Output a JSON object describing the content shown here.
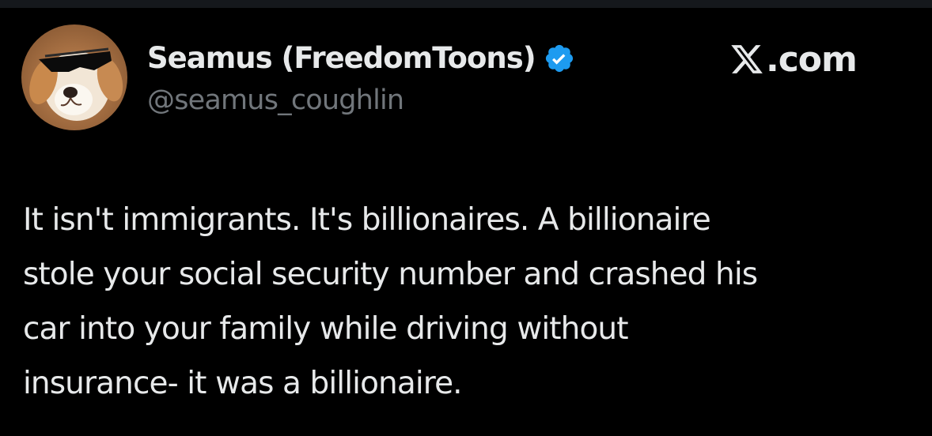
{
  "post": {
    "author": {
      "display_name": "Seamus (FreedomToons)",
      "handle": "@seamus_coughlin",
      "verified": true,
      "avatar_icon": "dog-with-sunglasses-avatar"
    },
    "site": {
      "label": ".com",
      "logo_icon": "x-logo-icon"
    },
    "text_lines": [
      "It isn't immigrants. It's billionaires. A billionaire",
      "stole your social security number and crashed his",
      "car into your family while driving without",
      "insurance- it was a billionaire."
    ]
  },
  "colors": {
    "background": "#000000",
    "primary_text": "#e7e9ea",
    "secondary_text": "#71767b",
    "verified_badge": "#1d9bf0"
  }
}
